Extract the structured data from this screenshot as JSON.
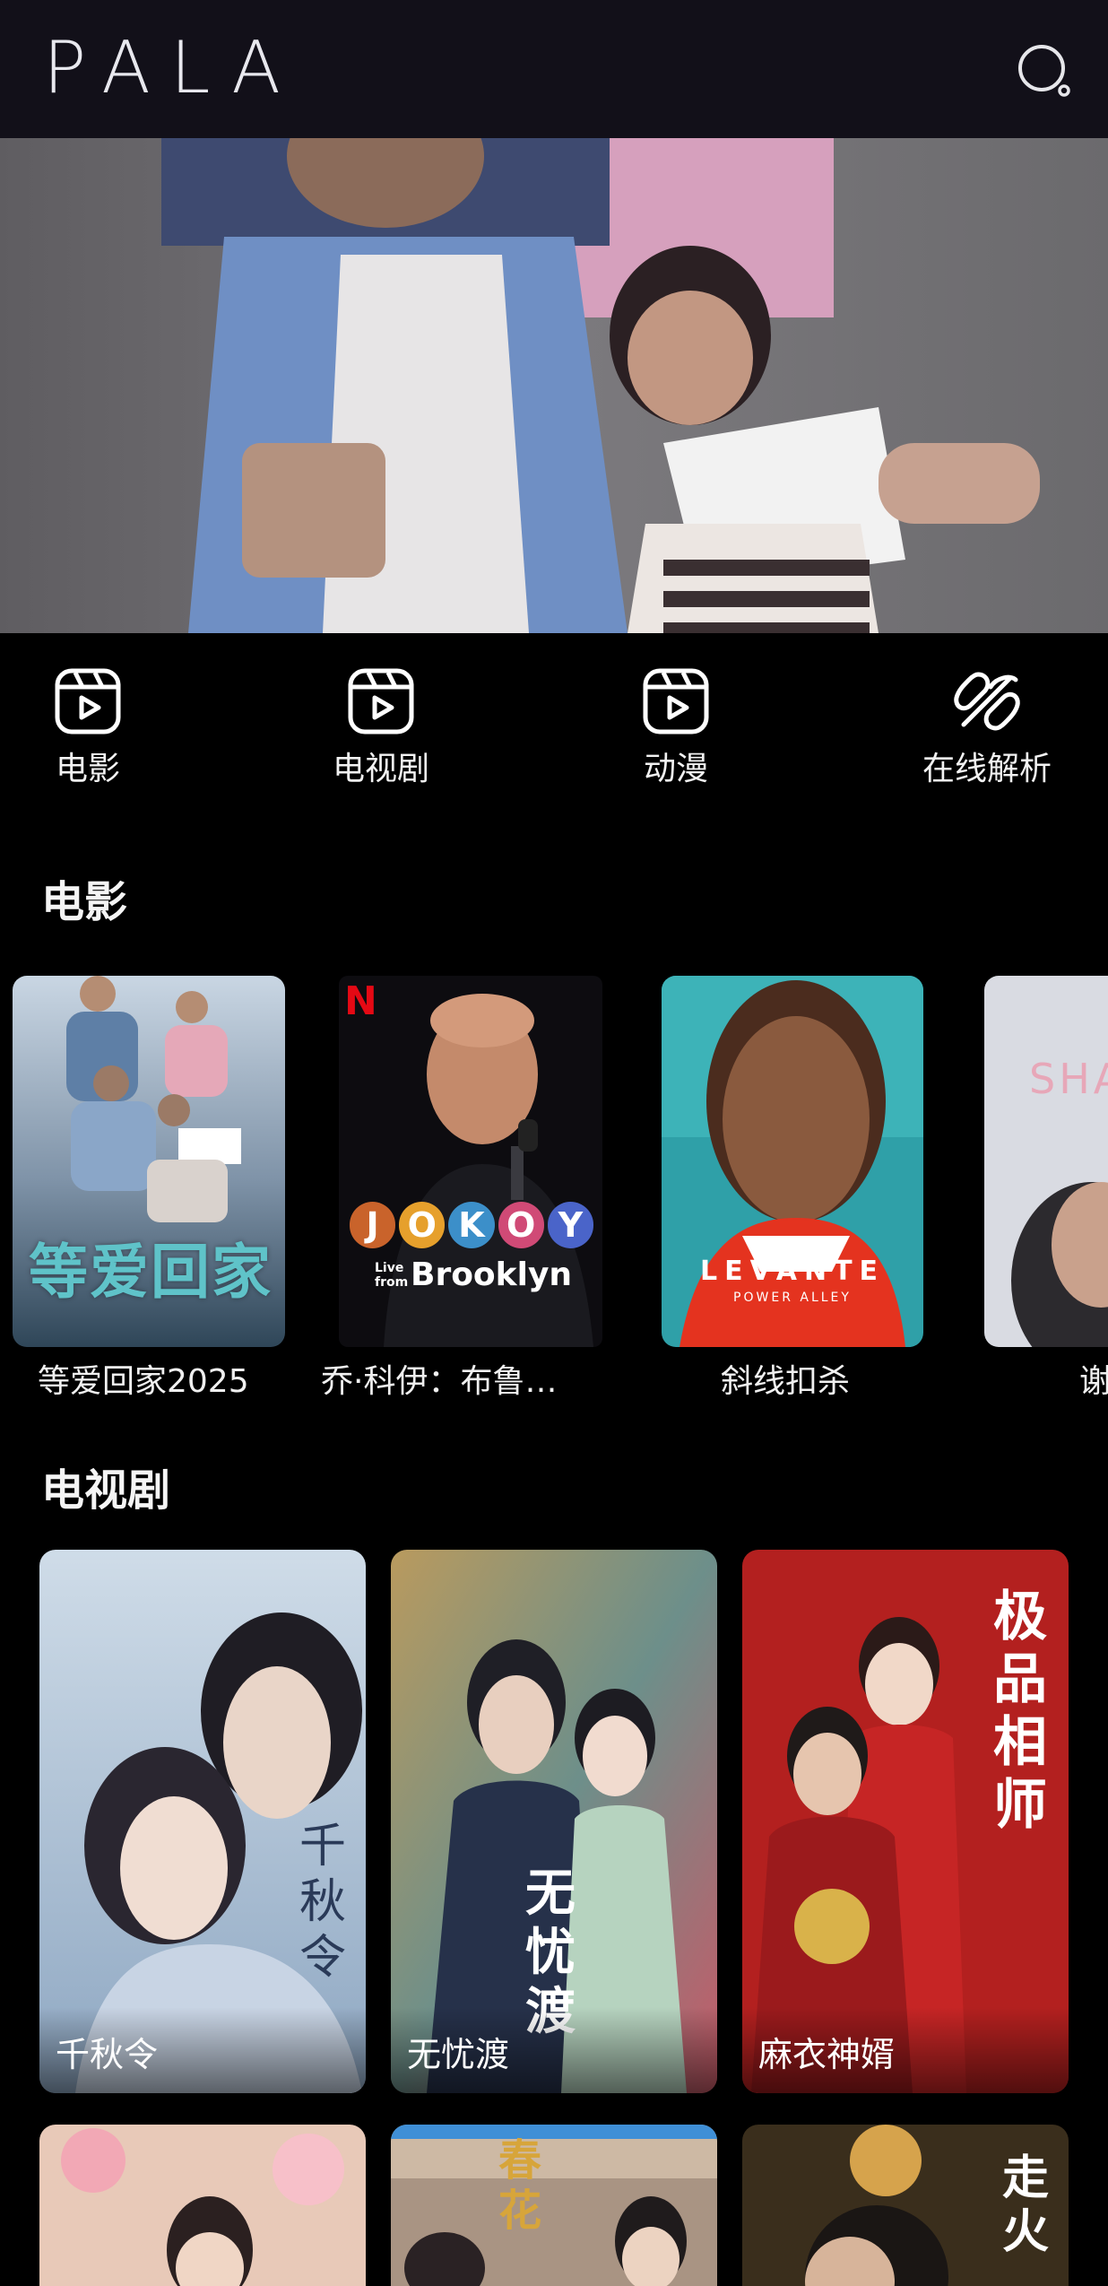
{
  "header": {
    "logo": "PALA",
    "search_icon": "search-icon"
  },
  "hero": {
    "image": "family-photo-banner"
  },
  "categories": [
    {
      "label": "电影",
      "icon": "play-reel-icon"
    },
    {
      "label": "电视剧",
      "icon": "play-reel-icon"
    },
    {
      "label": "动漫",
      "icon": "play-reel-icon"
    },
    {
      "label": "在线解析",
      "icon": "link-scissors-icon"
    }
  ],
  "sections": {
    "movies": {
      "title": "电影",
      "items": [
        {
          "title": "等爱回家2025",
          "poster_text": "等爱回家"
        },
        {
          "title": "乔·科伊：布鲁…",
          "poster_badge": "N",
          "poster_letters": [
            "J",
            "O",
            "K",
            "O",
            "Y"
          ],
          "poster_small": "Live from",
          "poster_text": "Brooklyn"
        },
        {
          "title": "斜线扣杀",
          "poster_text": "LEVANTE",
          "poster_sub": "POWER ALLEY"
        },
        {
          "title": "谢",
          "poster_text": "SHA"
        }
      ]
    },
    "tv": {
      "title": "电视剧",
      "items": [
        {
          "title": "千秋令",
          "poster_text": "千秋令"
        },
        {
          "title": "无忧渡",
          "poster_text": "无忧渡"
        },
        {
          "title": "麻衣神婿",
          "poster_text": "极品相师"
        }
      ],
      "row2": [
        {
          "poster_text": ""
        },
        {
          "poster_text": "春花"
        },
        {
          "poster_text": "走火"
        }
      ]
    }
  },
  "colors": {
    "topbar": "#121019",
    "background": "#000000",
    "text": "#ffffff"
  }
}
